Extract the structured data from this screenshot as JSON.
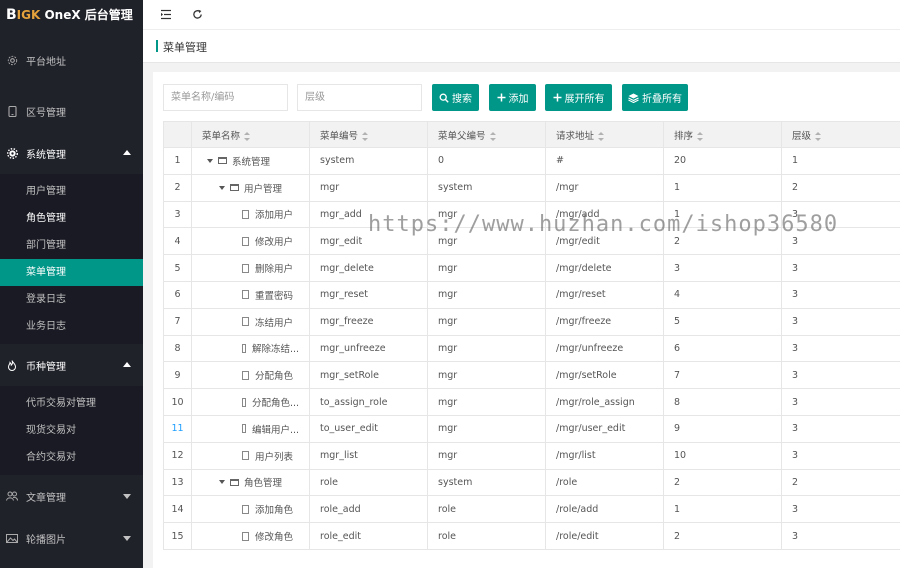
{
  "app": {
    "logo_b": "B",
    "logo_i": "I",
    "logo_gk": "GK",
    "logo_rest": " OneX 后台管理"
  },
  "sidebar": {
    "items": [
      {
        "label": "平台地址",
        "icon": "gear-icon"
      },
      {
        "label": "区号管理",
        "icon": "phone-icon"
      },
      {
        "label": "系统管理",
        "icon": "settings-icon",
        "open": true,
        "children": [
          "用户管理",
          "角色管理",
          "部门管理",
          "菜单管理",
          "登录日志",
          "业务日志"
        ],
        "active": "菜单管理"
      },
      {
        "label": "币种管理",
        "icon": "fire-icon",
        "open": true,
        "children": [
          "代币交易对管理",
          "现货交易对",
          "合约交易对"
        ]
      },
      {
        "label": "文章管理",
        "icon": "group-icon"
      },
      {
        "label": "轮播图片",
        "icon": "image-icon"
      }
    ]
  },
  "topbar": {
    "menu_icon": "shrink-menu-icon",
    "refresh_icon": "refresh-icon"
  },
  "page": {
    "title": "菜单管理"
  },
  "search": {
    "name_placeholder": "菜单名称/编码",
    "level_placeholder": "层级",
    "search_label": "搜索",
    "add_label": "添加",
    "expand_label": "展开所有",
    "collapse_label": "折叠所有"
  },
  "table": {
    "headers": [
      "菜单名称",
      "菜单编号",
      "菜单父编号",
      "请求地址",
      "排序",
      "层级"
    ],
    "rows": [
      {
        "idx": "1",
        "name": "系统管理",
        "code": "system",
        "parent": "0",
        "url": "#",
        "order": "20",
        "level": "1",
        "type": "folder",
        "depth": 0
      },
      {
        "idx": "2",
        "name": "用户管理",
        "code": "mgr",
        "parent": "system",
        "url": "/mgr",
        "order": "1",
        "level": "2",
        "type": "folder",
        "depth": 1
      },
      {
        "idx": "3",
        "name": "添加用户",
        "code": "mgr_add",
        "parent": "mgr",
        "url": "/mgr/add",
        "order": "1",
        "level": "3",
        "type": "file",
        "depth": 2
      },
      {
        "idx": "4",
        "name": "修改用户",
        "code": "mgr_edit",
        "parent": "mgr",
        "url": "/mgr/edit",
        "order": "2",
        "level": "3",
        "type": "file",
        "depth": 2
      },
      {
        "idx": "5",
        "name": "删除用户",
        "code": "mgr_delete",
        "parent": "mgr",
        "url": "/mgr/delete",
        "order": "3",
        "level": "3",
        "type": "file",
        "depth": 2
      },
      {
        "idx": "6",
        "name": "重置密码",
        "code": "mgr_reset",
        "parent": "mgr",
        "url": "/mgr/reset",
        "order": "4",
        "level": "3",
        "type": "file",
        "depth": 2
      },
      {
        "idx": "7",
        "name": "冻结用户",
        "code": "mgr_freeze",
        "parent": "mgr",
        "url": "/mgr/freeze",
        "order": "5",
        "level": "3",
        "type": "file",
        "depth": 2
      },
      {
        "idx": "8",
        "name": "解除冻结...",
        "code": "mgr_unfreeze",
        "parent": "mgr",
        "url": "/mgr/unfreeze",
        "order": "6",
        "level": "3",
        "type": "file",
        "depth": 2
      },
      {
        "idx": "9",
        "name": "分配角色",
        "code": "mgr_setRole",
        "parent": "mgr",
        "url": "/mgr/setRole",
        "order": "7",
        "level": "3",
        "type": "file",
        "depth": 2
      },
      {
        "idx": "10",
        "name": "分配角色...",
        "code": "to_assign_role",
        "parent": "mgr",
        "url": "/mgr/role_assign",
        "order": "8",
        "level": "3",
        "type": "file",
        "depth": 2
      },
      {
        "idx": "11",
        "name": "编辑用户...",
        "code": "to_user_edit",
        "parent": "mgr",
        "url": "/mgr/user_edit",
        "order": "9",
        "level": "3",
        "type": "file",
        "depth": 2
      },
      {
        "idx": "12",
        "name": "用户列表",
        "code": "mgr_list",
        "parent": "mgr",
        "url": "/mgr/list",
        "order": "10",
        "level": "3",
        "type": "file",
        "depth": 2
      },
      {
        "idx": "13",
        "name": "角色管理",
        "code": "role",
        "parent": "system",
        "url": "/role",
        "order": "2",
        "level": "2",
        "type": "folder",
        "depth": 1
      },
      {
        "idx": "14",
        "name": "添加角色",
        "code": "role_add",
        "parent": "role",
        "url": "/role/add",
        "order": "1",
        "level": "3",
        "type": "file",
        "depth": 2
      },
      {
        "idx": "15",
        "name": "修改角色",
        "code": "role_edit",
        "parent": "role",
        "url": "/role/edit",
        "order": "2",
        "level": "3",
        "type": "file",
        "depth": 2
      }
    ]
  },
  "watermark": "https://www.huzhan.com/ishop36580",
  "colors": {
    "accent": "#009688",
    "sidebar": "#20222a"
  }
}
